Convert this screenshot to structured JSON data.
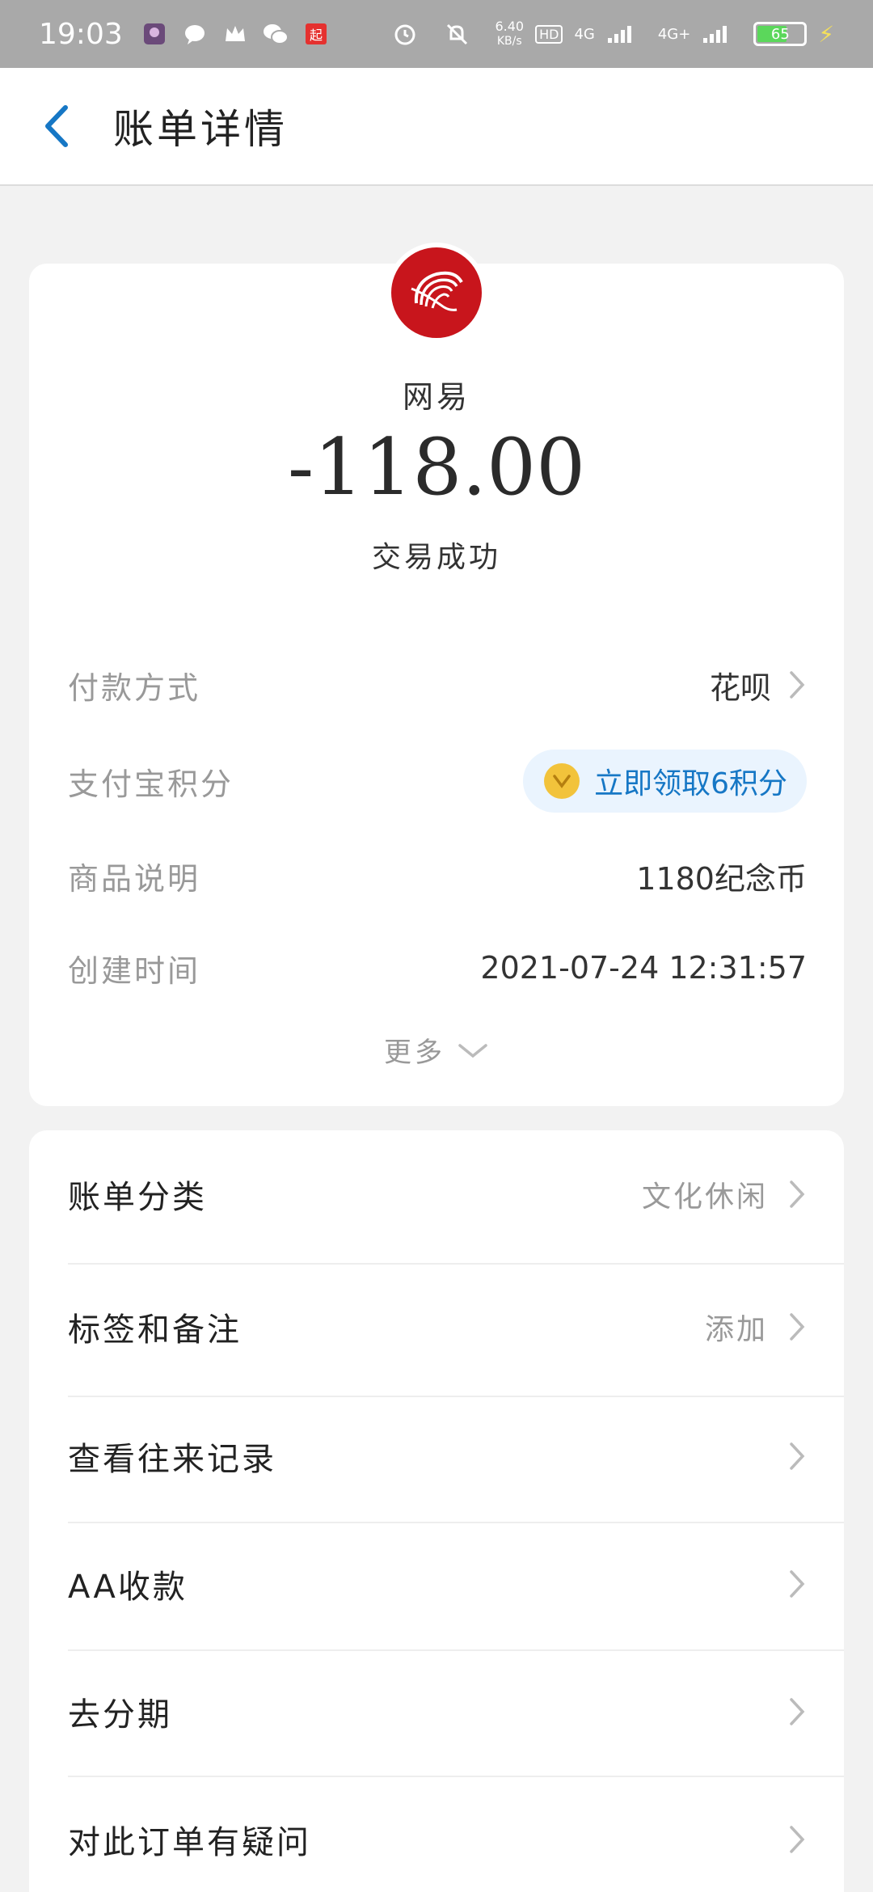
{
  "status_bar": {
    "time": "19:03",
    "net_speed_value": "6.40",
    "net_speed_unit": "KB/s",
    "hd_label": "HD",
    "signal1_label": "4G",
    "signal2_label": "4G+",
    "battery": "65"
  },
  "header": {
    "title": "账单详情"
  },
  "summary": {
    "merchant": "网易",
    "amount": "-118.00",
    "status": "交易成功"
  },
  "details": {
    "payment_method_label": "付款方式",
    "payment_method_value": "花呗",
    "points_label": "支付宝积分",
    "points_action": "立即领取6积分",
    "product_label": "商品说明",
    "product_value": "1180纪念币",
    "created_label": "创建时间",
    "created_value": "2021-07-24 12:31:57",
    "more_label": "更多"
  },
  "actions": [
    {
      "label": "账单分类",
      "value": "文化休闲"
    },
    {
      "label": "标签和备注",
      "value": "添加"
    },
    {
      "label": "查看往来记录",
      "value": ""
    },
    {
      "label": "AA收款",
      "value": ""
    },
    {
      "label": "去分期",
      "value": ""
    },
    {
      "label": "对此订单有疑问",
      "value": ""
    }
  ],
  "colors": {
    "accent": "#1677c5",
    "logo_red": "#c8151c",
    "status_bar": "#a9a9a9"
  }
}
